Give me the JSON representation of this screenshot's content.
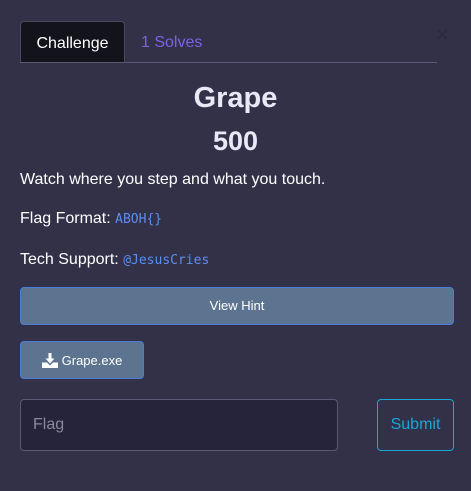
{
  "tabs": {
    "challenge": "Challenge",
    "solves": "1 Solves"
  },
  "close_symbol": "×",
  "challenge": {
    "name": "Grape",
    "points": "500",
    "description": "Watch where you step and what you touch.",
    "flag_format_label": "Flag Format:",
    "flag_format_value": "ABOH{}",
    "tech_support_label": "Tech Support:",
    "tech_support_value": "@JesusCries"
  },
  "hint_button": "View Hint",
  "file": {
    "name": "Grape.exe",
    "icon": "download-icon"
  },
  "flag_input": {
    "placeholder": "Flag",
    "value": ""
  },
  "submit_button": "Submit",
  "colors": {
    "background": "#333148",
    "accent_purple": "#7d62e6",
    "code_blue": "#5b8ef0",
    "button_fill": "#5d7490",
    "submit_cyan": "#1aa6d9"
  }
}
